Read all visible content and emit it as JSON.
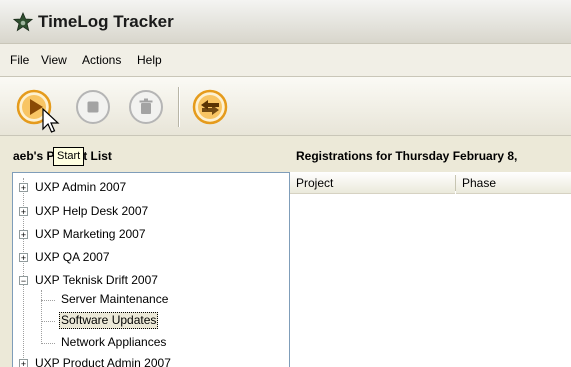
{
  "app": {
    "title": "TimeLog Tracker"
  },
  "menu": [
    "File",
    "View",
    "Actions",
    "Help"
  ],
  "toolbar": {
    "buttons": [
      {
        "name": "start",
        "icon": "play-icon"
      },
      {
        "name": "stop",
        "icon": "stop-icon"
      },
      {
        "name": "delete",
        "icon": "trash-icon"
      },
      {
        "name": "sync",
        "icon": "swap-arrows-icon"
      }
    ],
    "tooltip": "Start"
  },
  "left_panel": {
    "header": "aeb's Project List"
  },
  "right_panel": {
    "header": "Registrations for Thursday February 8,",
    "columns": [
      "Project",
      "Phase"
    ]
  },
  "tree": {
    "items": [
      {
        "label": "UXP Admin 2007",
        "expanded": false
      },
      {
        "label": "UXP Help Desk 2007",
        "expanded": false
      },
      {
        "label": "UXP Marketing 2007",
        "expanded": false
      },
      {
        "label": "UXP QA 2007",
        "expanded": false
      },
      {
        "label": "UXP Teknisk Drift 2007",
        "expanded": true,
        "children": [
          "Server Maintenance",
          "Software Updates",
          "Network Appliances"
        ],
        "selected_child": "Software Updates"
      },
      {
        "label": "UXP Product Admin 2007",
        "expanded": false
      }
    ]
  },
  "colors": {
    "accent_orange": "#f39c12",
    "tree_border": "#7f9db9",
    "tooltip_bg": "#ffffe1"
  }
}
